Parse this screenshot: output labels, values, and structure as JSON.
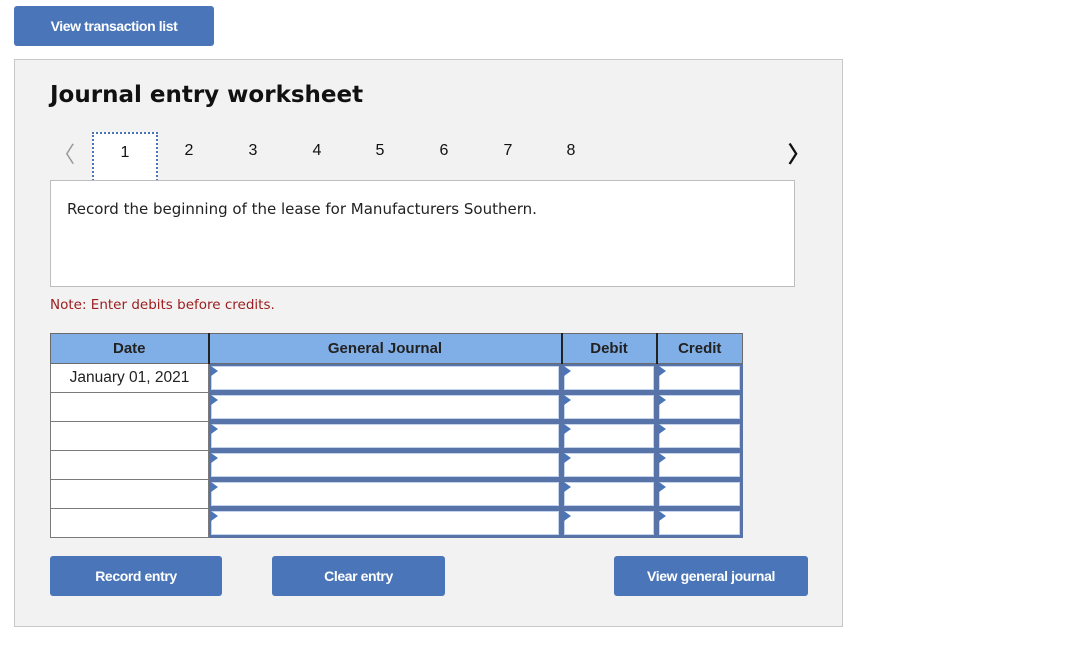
{
  "top_button": {
    "label": "View transaction list"
  },
  "worksheet": {
    "title": "Journal entry worksheet",
    "pager": {
      "prev_icon": "chevron-left-icon",
      "next_icon": "chevron-right-icon",
      "pages": [
        "1",
        "2",
        "3",
        "4",
        "5",
        "6",
        "7",
        "8"
      ],
      "active_page": "1"
    },
    "description": "Record the beginning of the lease for Manufacturers Southern.",
    "note": "Note: Enter debits before credits.",
    "table": {
      "headers": {
        "date": "Date",
        "general_journal": "General Journal",
        "debit": "Debit",
        "credit": "Credit"
      },
      "rows": [
        {
          "date": "January 01, 2021",
          "account": "",
          "debit": "",
          "credit": ""
        },
        {
          "date": "",
          "account": "",
          "debit": "",
          "credit": ""
        },
        {
          "date": "",
          "account": "",
          "debit": "",
          "credit": ""
        },
        {
          "date": "",
          "account": "",
          "debit": "",
          "credit": ""
        },
        {
          "date": "",
          "account": "",
          "debit": "",
          "credit": ""
        },
        {
          "date": "",
          "account": "",
          "debit": "",
          "credit": ""
        }
      ]
    },
    "buttons": {
      "record": "Record entry",
      "clear": "Clear entry",
      "view_general": "View general journal"
    }
  }
}
